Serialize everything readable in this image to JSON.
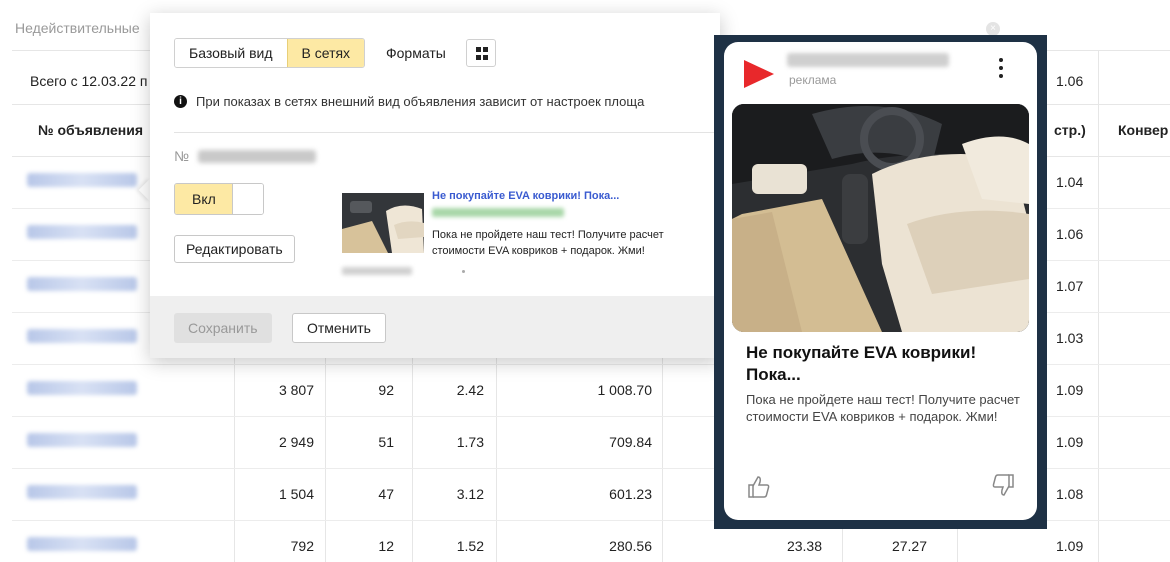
{
  "background": {
    "tab_label": "Недействительные",
    "close_glyph": "×",
    "total_label": "Всего с 12.03.22 п",
    "total_ctr": "1.06",
    "headers": {
      "ad_number": "№ объявления",
      "ctr": "стр.)",
      "conversion": "Конвер"
    },
    "rows": [
      {
        "shows": "",
        "clicks": "",
        "ctr": "",
        "cost": "",
        "avg": "",
        "conv": "",
        "right": "1.04"
      },
      {
        "shows": "",
        "clicks": "",
        "ctr": "",
        "cost": "",
        "avg": "",
        "conv": "",
        "right": "1.06"
      },
      {
        "shows": "",
        "clicks": "",
        "ctr": "",
        "cost": "",
        "avg": "",
        "conv": "",
        "right": "1.07"
      },
      {
        "shows": "",
        "clicks": "",
        "ctr": "",
        "cost": "",
        "avg": "",
        "conv": "",
        "right": "1.03"
      },
      {
        "shows": "3 807",
        "clicks": "92",
        "ctr": "2.42",
        "cost": "1 008.70",
        "avg": "",
        "conv": "",
        "right": "1.09"
      },
      {
        "shows": "2 949",
        "clicks": "51",
        "ctr": "1.73",
        "cost": "709.84",
        "avg": "",
        "conv": "",
        "right": "1.09"
      },
      {
        "shows": "1 504",
        "clicks": "47",
        "ctr": "3.12",
        "cost": "601.23",
        "avg": "",
        "conv": "",
        "right": "1.08"
      },
      {
        "shows": "792",
        "clicks": "12",
        "ctr": "1.52",
        "cost": "280.56",
        "avg": "23.38",
        "conv": "27.27",
        "right": "1.09"
      }
    ]
  },
  "popup": {
    "tabs": [
      "Базовый вид",
      "В сетях"
    ],
    "active_tab": 1,
    "formats_label": "Форматы",
    "info_glyph": "i",
    "info_text": "При показах в сетях внешний вид объявления зависит от настроек площа",
    "number_label": "№",
    "toggle_label": "Вкл",
    "edit_label": "Редактировать",
    "mini_ad": {
      "title": "Не покупайте EVA коврики! Пока...",
      "text_line1": "Пока не пройдете наш тест! Получите расчет",
      "text_line2": "стоимости EVA ковриков + подарок. Жми!"
    },
    "save_label": "Сохранить",
    "cancel_label": "Отменить"
  },
  "preview": {
    "ad_tag": "реклама",
    "title": "Не покупайте EVA коврики! Пока...",
    "text": "Пока не пройдете наш тест! Получите расчет стоимости EVA ковриков + подарок. Жми!",
    "icons": {
      "brand": "red-arrow-logo",
      "menu": "kebab-menu",
      "like": "thumbs-up",
      "dislike": "thumbs-down"
    }
  },
  "colors": {
    "accent_yellow": "#fde9a4",
    "link_blue": "#3a5bd0",
    "frame_navy": "#1e3145",
    "brand_red": "#e8282b"
  }
}
